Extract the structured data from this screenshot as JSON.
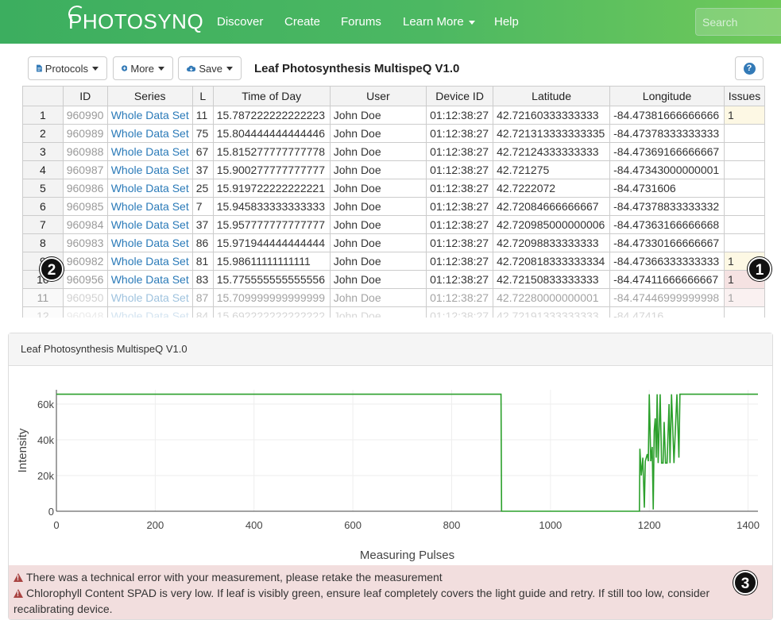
{
  "nav": {
    "logo": "PHOTOSYNQ",
    "items": [
      "Discover",
      "Create",
      "Forums",
      "Learn More",
      "Help"
    ],
    "search_placeholder": "Search"
  },
  "toolbar": {
    "protocols_label": "Protocols",
    "more_label": "More",
    "save_label": "Save",
    "title": "Leaf Photosynthesis MultispeQ V1.0",
    "help_label": "?"
  },
  "grid": {
    "columns": [
      "",
      "ID",
      "Series",
      "L",
      "Time of Day",
      "User",
      "Device ID",
      "Latitude",
      "Longitude",
      "Issues"
    ],
    "rows": [
      [
        "1",
        "960990",
        "Whole Data Set",
        "11",
        "15.787222222222223",
        "John Doe",
        "01:12:38:27",
        "42.72160333333333",
        "-84.47381666666666",
        "1"
      ],
      [
        "2",
        "960989",
        "Whole Data Set",
        "75",
        "15.804444444444446",
        "John Doe",
        "01:12:38:27",
        "42.721313333333335",
        "-84.47378333333333",
        ""
      ],
      [
        "3",
        "960988",
        "Whole Data Set",
        "67",
        "15.815277777777778",
        "John Doe",
        "01:12:38:27",
        "42.72124333333333",
        "-84.47369166666667",
        ""
      ],
      [
        "4",
        "960987",
        "Whole Data Set",
        "37",
        "15.900277777777777",
        "John Doe",
        "01:12:38:27",
        "42.721275",
        "-84.47343000000001",
        ""
      ],
      [
        "5",
        "960986",
        "Whole Data Set",
        "25",
        "15.919722222222221",
        "John Doe",
        "01:12:38:27",
        "42.7222072",
        "-84.4731606",
        ""
      ],
      [
        "6",
        "960985",
        "Whole Data Set",
        "7",
        "15.945833333333333",
        "John Doe",
        "01:12:38:27",
        "42.72084666666667",
        "-84.47378833333332",
        ""
      ],
      [
        "7",
        "960984",
        "Whole Data Set",
        "37",
        "15.957777777777777",
        "John Doe",
        "01:12:38:27",
        "42.720985000000006",
        "-84.47363166666668",
        ""
      ],
      [
        "8",
        "960983",
        "Whole Data Set",
        "86",
        "15.971944444444444",
        "John Doe",
        "01:12:38:27",
        "42.72098833333333",
        "-84.47330166666667",
        ""
      ],
      [
        "9",
        "960982",
        "Whole Data Set",
        "81",
        "15.98611111111111",
        "John Doe",
        "01:12:38:27",
        "42.720818333333334",
        "-84.47366333333333",
        "1"
      ],
      [
        "10",
        "960956",
        "Whole Data Set",
        "83",
        "15.775555555555556",
        "John Doe",
        "01:12:38:27",
        "42.72150833333333",
        "-84.47411666666667",
        "1"
      ],
      [
        "11",
        "960950",
        "Whole Data Set",
        "87",
        "15.709999999999999",
        "John Doe",
        "01:12:38:27",
        "42.72280000000001",
        "-84.47446999999998",
        "1"
      ],
      [
        "12",
        "960948",
        "Whole Data Set",
        "84",
        "15.692222222222222",
        "John Doe",
        "01:12:38:27",
        "42.72191333333333",
        "-84.47416",
        ""
      ]
    ]
  },
  "markers": [
    "1",
    "2",
    "3"
  ],
  "panel": {
    "title": "Leaf Photosynthesis MultispeQ V1.0"
  },
  "chart_data": {
    "type": "line",
    "xlabel": "Measuring Pulses",
    "ylabel": "Intensity",
    "xlim": [
      0,
      1420
    ],
    "ylim": [
      0,
      68000
    ],
    "x_ticks": [
      0,
      200,
      400,
      600,
      800,
      1000,
      1200,
      1400
    ],
    "y_ticks": [
      0,
      20000,
      40000,
      60000
    ],
    "y_tick_labels": [
      "0",
      "20k",
      "40k",
      "60k"
    ],
    "grid": true,
    "color": "#2ca02c",
    "series": [
      {
        "x": [
          0,
          900,
          901,
          1180,
          1181,
          1184,
          1187,
          1190,
          1192,
          1196,
          1198,
          1200,
          1203,
          1206,
          1208,
          1210,
          1212,
          1214,
          1216,
          1218,
          1220,
          1222,
          1225,
          1228,
          1230,
          1233,
          1236,
          1240,
          1242,
          1245,
          1250,
          1252,
          1256,
          1260,
          1262,
          1265,
          1268,
          1420
        ],
        "y": [
          65500,
          65500,
          0,
          0,
          35000,
          20000,
          30000,
          2000,
          28000,
          32000,
          28000,
          65500,
          28000,
          36000,
          1000,
          45000,
          52000,
          30000,
          65500,
          27000,
          45000,
          65500,
          27000,
          27000,
          50000,
          27000,
          27000,
          60000,
          27000,
          65500,
          27000,
          40000,
          65500,
          30000,
          65500,
          65500,
          65500,
          65500
        ]
      }
    ]
  },
  "alerts": [
    "There was a technical error with your measurement, please retake the measurement",
    "Chlorophyll Content SPAD is very low. If leaf is visibly green, ensure leaf completely covers the light guide and retry. If still too low, consider recalibrating device."
  ]
}
